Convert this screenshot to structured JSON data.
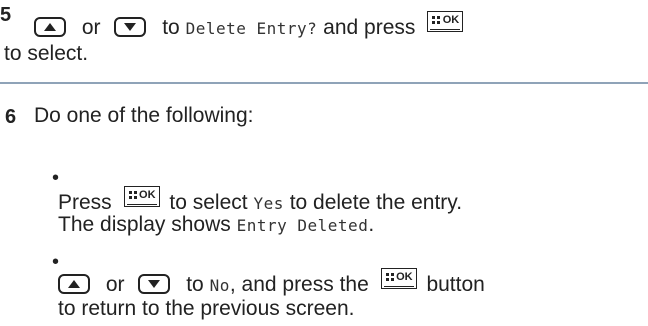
{
  "step5": {
    "number": "5",
    "or": "or",
    "to": "to",
    "code": "Delete Entry?",
    "and_press": "and press",
    "line2": "to select."
  },
  "step6": {
    "number": "6",
    "intro": "Do one of the following:",
    "bullet1": {
      "press": "Press",
      "to_select": "to select",
      "code_yes": "Yes",
      "to_delete": "to delete the entry.",
      "display_shows": "The display shows",
      "code_deleted": "Entry Deleted",
      "period": "."
    },
    "bullet2": {
      "or": "or",
      "to": "to",
      "code_no": "No",
      "and_press_the": ", and press the",
      "button": "button",
      "line2": "to return to the previous screen."
    }
  },
  "ok_label": "OK",
  "bullet_glyph": "•"
}
